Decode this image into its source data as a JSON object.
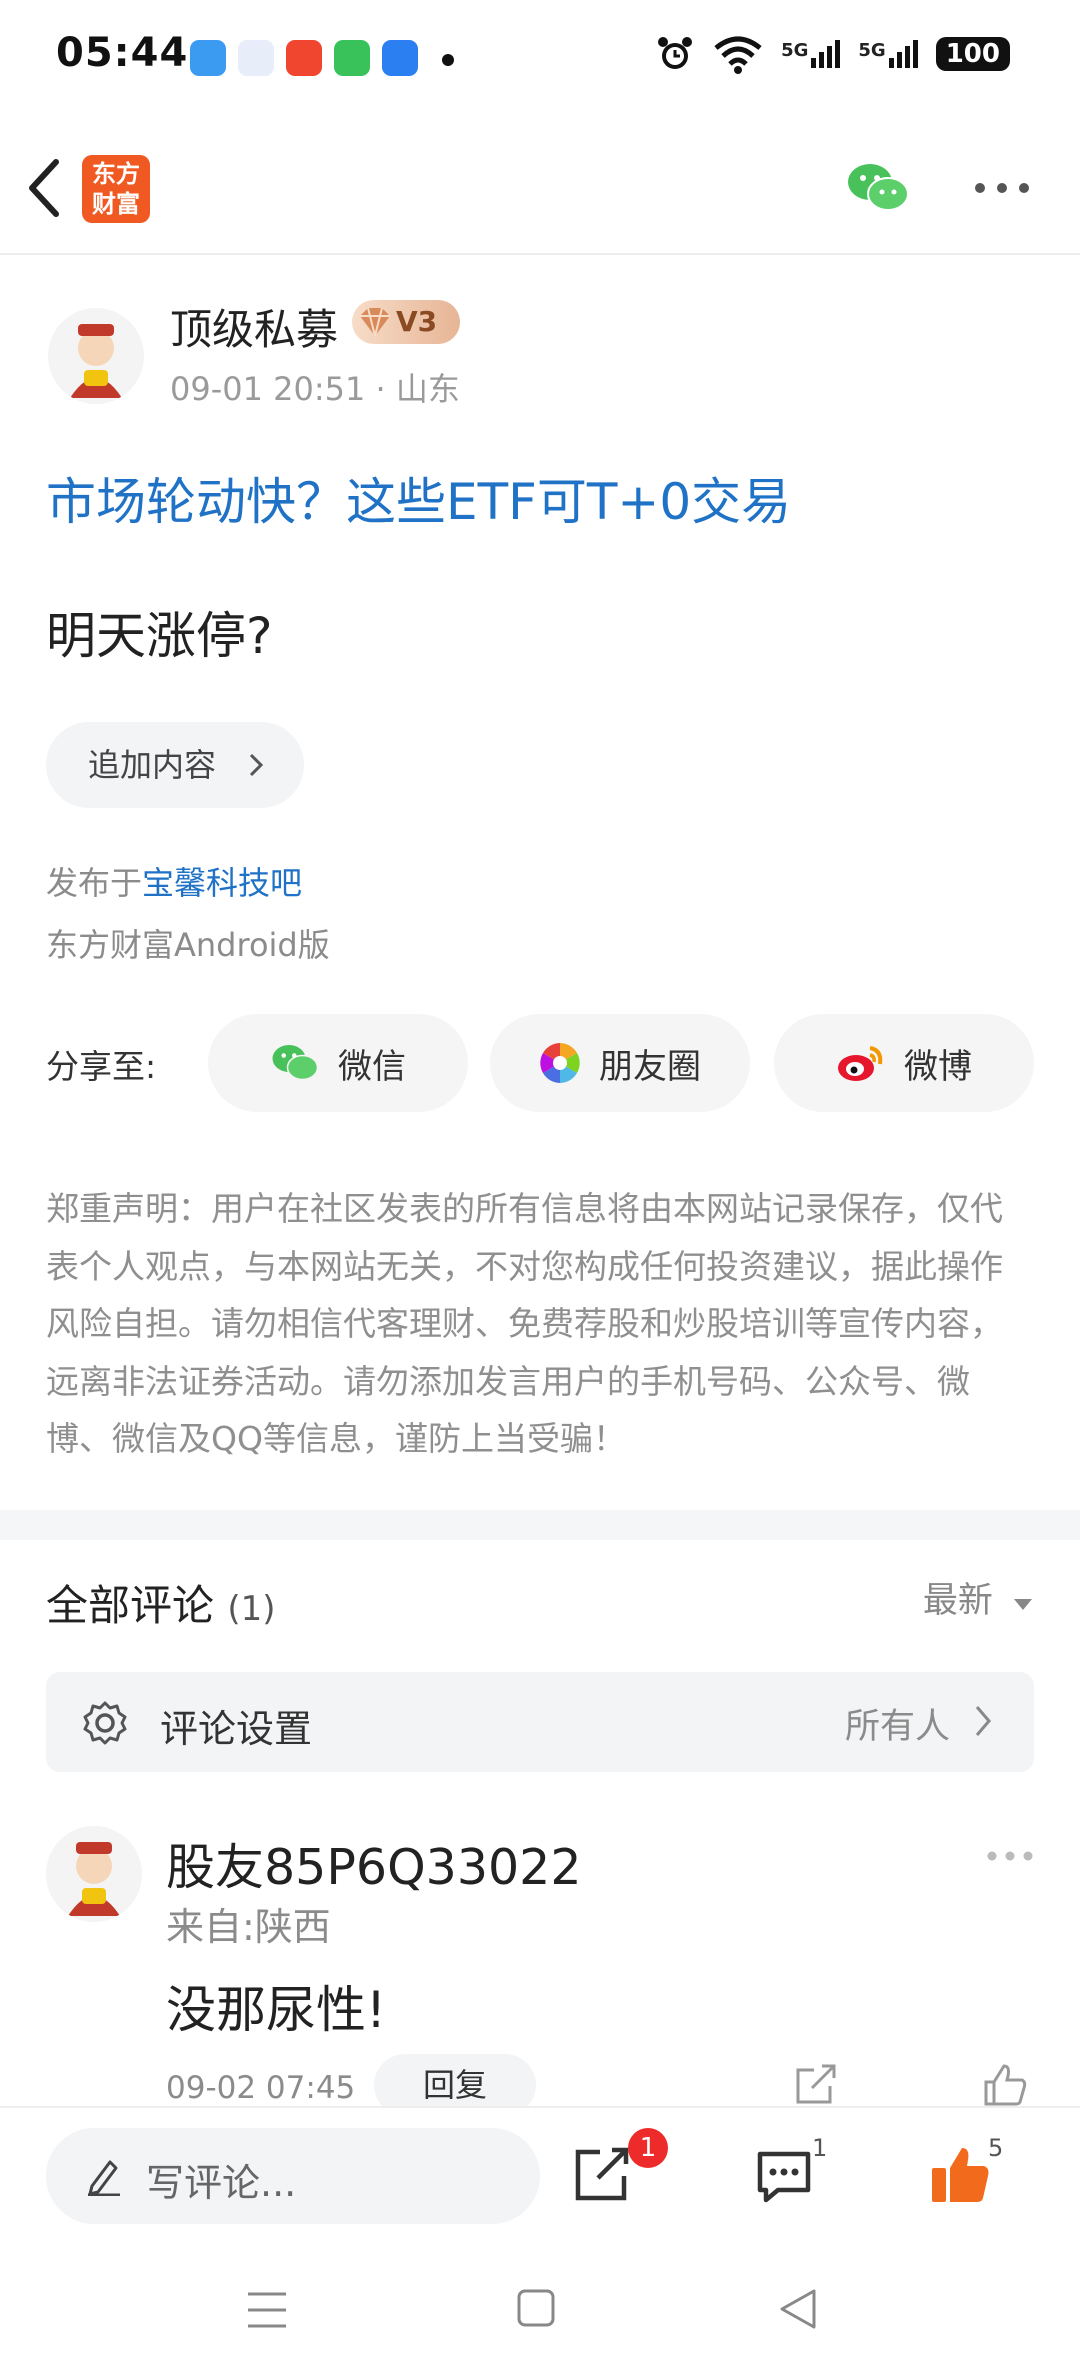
{
  "status_bar": {
    "time": "05:44",
    "battery": "100",
    "signal_a": "5G",
    "signal_b": "5G"
  },
  "nav": {
    "logo_line1": "东方",
    "logo_line2": "财富"
  },
  "post": {
    "author": "顶级私募",
    "badge": "V3",
    "time": "09-01 20:51",
    "location": "山东",
    "meta_sep": "·",
    "title": "市场轮动快？这些ETF可T+0交易",
    "body": "明天涨停?",
    "append_label": "追加内容",
    "published_prefix": "发布于",
    "published_bar": "宝馨科技吧",
    "client": "东方财富Android版"
  },
  "share": {
    "label": "分享至:",
    "wechat": "微信",
    "moments": "朋友圈",
    "weibo": "微博"
  },
  "disclaimer": "郑重声明：用户在社区发表的所有信息将由本网站记录保存，仅代表个人观点，与本网站无关，不对您构成任何投资建议，据此操作风险自担。请勿相信代客理财、免费荐股和炒股培训等宣传内容，远离非法证券活动。请勿添加发言用户的手机号码、公众号、微博、微信及QQ等信息，谨防上当受骗！",
  "comments": {
    "title": "全部评论",
    "count": "(1)",
    "sort": "最新",
    "settings_label": "评论设置",
    "settings_value": "所有人",
    "items": [
      {
        "user": "股友85P6Q33022",
        "from": "来自:陕西",
        "text": "没那尿性!",
        "time": "09-02 07:45",
        "reply": "回复"
      }
    ]
  },
  "bottom": {
    "input_placeholder": "写评论...",
    "share_badge": "1",
    "comment_count": "1",
    "like_count": "5"
  },
  "colors": {
    "link": "#1f72c6",
    "like": "#f26b1d",
    "badge": "#ee2b2b",
    "brand": "#f05a22"
  }
}
